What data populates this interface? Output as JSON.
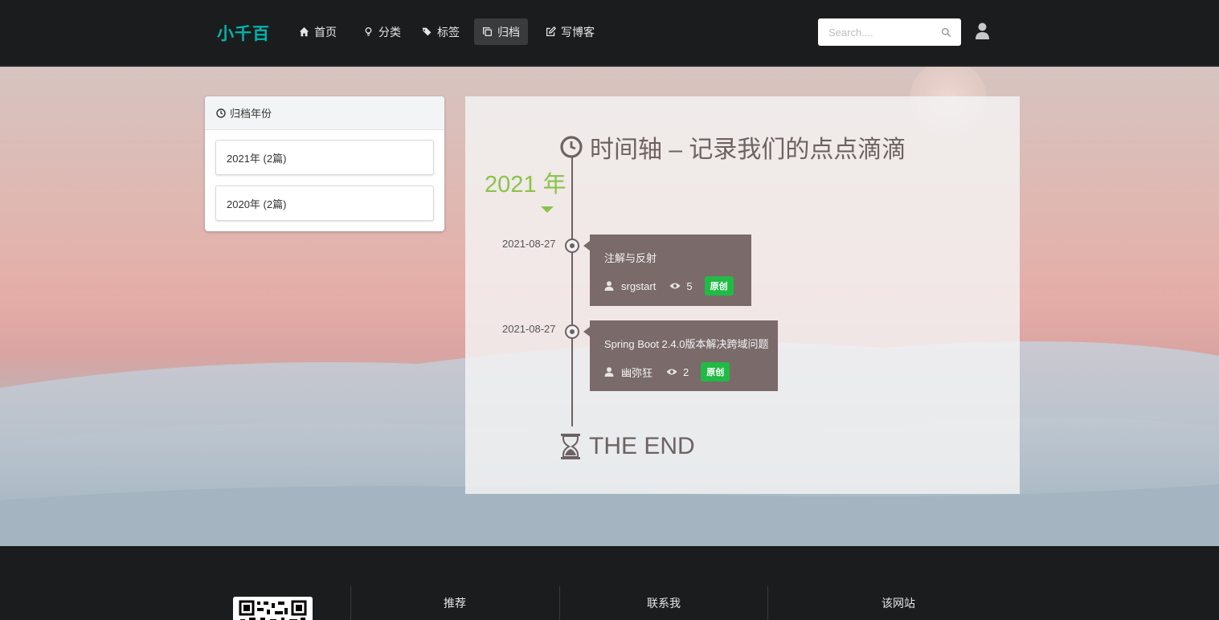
{
  "navbar": {
    "brand": "小千百",
    "items": [
      {
        "label": "首页",
        "icon": "home-icon"
      },
      {
        "label": "分类",
        "icon": "lightbulb-icon"
      },
      {
        "label": "标签",
        "icon": "tags-icon"
      },
      {
        "label": "归档",
        "icon": "clone-icon",
        "active": true
      },
      {
        "label": "写博客",
        "icon": "edit-icon"
      }
    ],
    "search_placeholder": "Search....",
    "user_icon": "user-icon"
  },
  "sidebar": {
    "title": "归档年份",
    "years": [
      {
        "label": "2021年 (2篇)"
      },
      {
        "label": "2020年 (2篇)"
      }
    ]
  },
  "timeline": {
    "heading": "时间轴 – 记录我们的点点滴滴",
    "year": "2021 年",
    "posts": [
      {
        "date": "2021-08-27",
        "title": "注解与反射",
        "author": "srgstart",
        "views": "5",
        "badge": "原创"
      },
      {
        "date": "2021-08-27",
        "title": "Spring Boot 2.4.0版本解决跨域问题",
        "author": "幽弥狂",
        "views": "2",
        "badge": "原创"
      }
    ],
    "end_label": "THE END"
  },
  "footer": {
    "columns": [
      "推荐",
      "联系我",
      "该网站"
    ]
  },
  "colors": {
    "brand": "#00b5ad",
    "year_accent": "#8bc34a",
    "badge": "#21ba45",
    "post_card": "#7a6a6a",
    "navbar": "#1b1c1d"
  }
}
